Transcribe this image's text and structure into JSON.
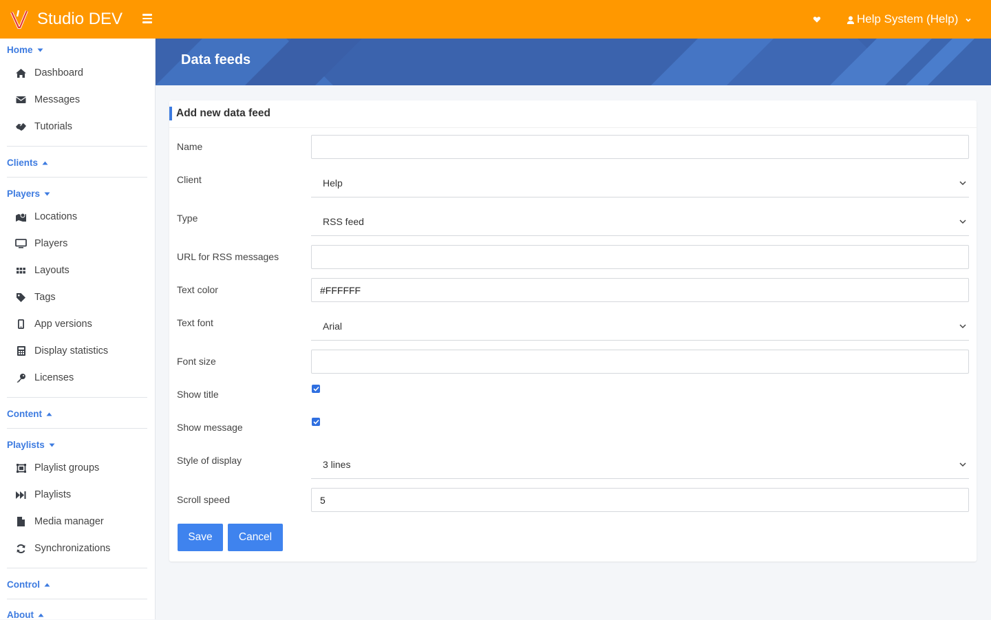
{
  "app": {
    "title": "Studio DEV"
  },
  "user": {
    "name": "Help System (Help)"
  },
  "sidebar": {
    "sections": {
      "home": "Home",
      "clients": "Clients",
      "players": "Players",
      "content": "Content",
      "playlists": "Playlists",
      "control": "Control",
      "about": "About"
    },
    "items": {
      "dashboard": "Dashboard",
      "messages": "Messages",
      "tutorials": "Tutorials",
      "locations": "Locations",
      "players": "Players",
      "layouts": "Layouts",
      "tags": "Tags",
      "app_versions": "App versions",
      "display_statistics": "Display statistics",
      "licenses": "Licenses",
      "playlist_groups": "Playlist groups",
      "playlists": "Playlists",
      "media_manager": "Media manager",
      "synchronizations": "Synchronizations"
    }
  },
  "page": {
    "title": "Data feeds"
  },
  "form": {
    "title": "Add new data feed",
    "name": {
      "label": "Name",
      "value": ""
    },
    "client": {
      "label": "Client",
      "value": "Help"
    },
    "type": {
      "label": "Type",
      "value": "RSS feed"
    },
    "url": {
      "label": "URL for RSS messages",
      "value": ""
    },
    "text_color": {
      "label": "Text color",
      "value": "#FFFFFF"
    },
    "text_font": {
      "label": "Text font",
      "value": "Arial"
    },
    "font_size": {
      "label": "Font size",
      "value": ""
    },
    "show_title": {
      "label": "Show title",
      "checked": true
    },
    "show_message": {
      "label": "Show message",
      "checked": true
    },
    "style": {
      "label": "Style of display",
      "value": "3 lines"
    },
    "scroll_speed": {
      "label": "Scroll speed",
      "value": "5"
    },
    "save_label": "Save",
    "cancel_label": "Cancel"
  },
  "colors": {
    "topbar": "#ff9800",
    "accent": "#3d7be0",
    "button": "#3f83ee",
    "banner": "#3d6db8"
  }
}
